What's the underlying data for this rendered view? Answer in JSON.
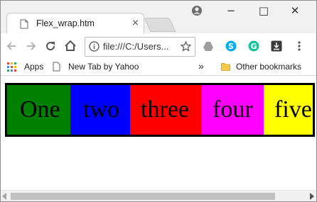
{
  "tab": {
    "title": "Flex_wrap.htm",
    "close": "×"
  },
  "window": {
    "minimize": "−",
    "maximize": "□",
    "close": "✕"
  },
  "toolbar": {
    "url": "file:///C:/Users..."
  },
  "bookmarks": {
    "apps": "Apps",
    "newtab": "New Tab by Yahoo",
    "overflow": "»",
    "other": "Other bookmarks"
  },
  "boxes": [
    {
      "label": "One",
      "color": "#008000"
    },
    {
      "label": "two",
      "color": "#0000ff"
    },
    {
      "label": "three",
      "color": "#ff0000"
    },
    {
      "label": "four",
      "color": "#ff00ff"
    },
    {
      "label": "five",
      "color": "#ffff00"
    }
  ],
  "colors": {
    "container_border": "#000000"
  }
}
